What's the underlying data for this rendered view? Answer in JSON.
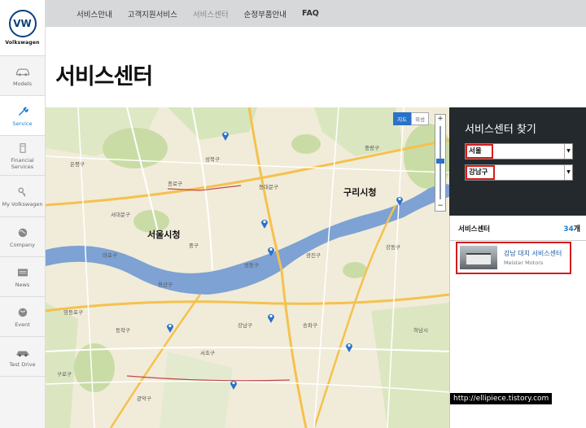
{
  "brand": {
    "name": "Volkswagen",
    "logo_text": "VW"
  },
  "sidebar": {
    "items": [
      {
        "label": "Models",
        "icon": "car-icon"
      },
      {
        "label": "Service",
        "icon": "wrench-icon",
        "active": true
      },
      {
        "label": "Financial Services",
        "icon": "calculator-icon"
      },
      {
        "label": "My Volkswagen",
        "icon": "key-icon"
      },
      {
        "label": "Company",
        "icon": "globe-icon"
      },
      {
        "label": "News",
        "icon": "news-icon"
      },
      {
        "label": "Event",
        "icon": "globe-icon"
      },
      {
        "label": "Test Drive",
        "icon": "car-icon"
      }
    ]
  },
  "topnav": {
    "items": [
      "서비스안내",
      "고객지원서비스",
      "서비스센터",
      "순정부품안내",
      "FAQ"
    ]
  },
  "page": {
    "title": "서비스센터"
  },
  "map": {
    "map_type": {
      "map": "지도",
      "satellite": "위성"
    },
    "zoom": {
      "plus": "+",
      "minus": "−"
    },
    "labels": {
      "seoul_city_hall": "서울시청",
      "guri_city_hall": "구리시청",
      "seongbuk": "성북구",
      "jongno": "종로구",
      "jung": "중구",
      "yongsan": "용산구",
      "gangnam": "강남구",
      "seocho": "서초구",
      "songpa": "송파구",
      "gwangjin": "광진구",
      "dongdaemun": "동대문구",
      "mapo": "마포구",
      "yeongdeungpo": "영등포구",
      "dongjak": "동작구",
      "gangdong": "강동구",
      "hanam": "하남시",
      "eunpyeong": "은평구",
      "seodaemun": "서대문구",
      "jungnang": "중랑구",
      "gwanak": "관악구",
      "guro": "구로구",
      "seongdong": "성동구"
    }
  },
  "finder": {
    "title": "서비스센터 찾기",
    "city_select": "서울",
    "district_select": "강남구"
  },
  "results": {
    "header": "서비스센터",
    "count": "34",
    "count_unit": "개",
    "items": [
      {
        "name": "강남 대치 서비스센터",
        "dealer": "Meister Motors"
      }
    ]
  },
  "watermark": "http://ellipiece.tistory.com",
  "colors": {
    "accent": "#1a7fd0",
    "highlight": "#d41c1c",
    "panel": "#24292d",
    "river": "#7da2d3"
  }
}
